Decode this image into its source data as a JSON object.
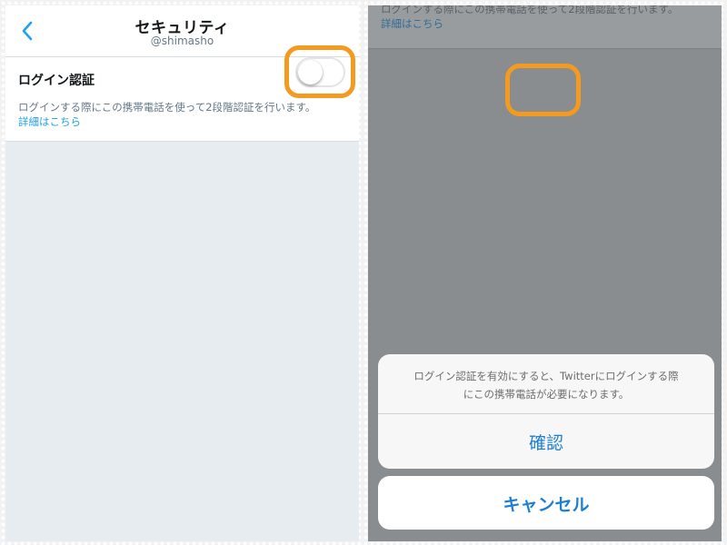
{
  "left_screen": {
    "nav": {
      "back_icon": "chevron-left-icon",
      "title": "セキュリティ",
      "subtitle": "@shimasho"
    },
    "login_verification": {
      "label": "ログイン認証",
      "toggle_state": "off",
      "description": "ログインする際にこの携帯電話を使って2段階認証を行います。",
      "link_text": "詳細はこちら"
    }
  },
  "right_screen": {
    "background_text": "ログインする際にこの携帯電話を使って2段階認証を行います。",
    "background_link": "詳細はこちら",
    "action_sheet": {
      "message_line1": "ログイン認証を有効にすると、Twitterにログインする際",
      "message_line2": "にこの携帯電話が必要になります。",
      "confirm_label": "確認",
      "cancel_label": "キャンセル"
    }
  },
  "colors": {
    "accent": "#1da1f2",
    "action_blue": "#1d7fd4",
    "highlight": "#f39a1f",
    "dim_overlay": "#8a8d90"
  }
}
